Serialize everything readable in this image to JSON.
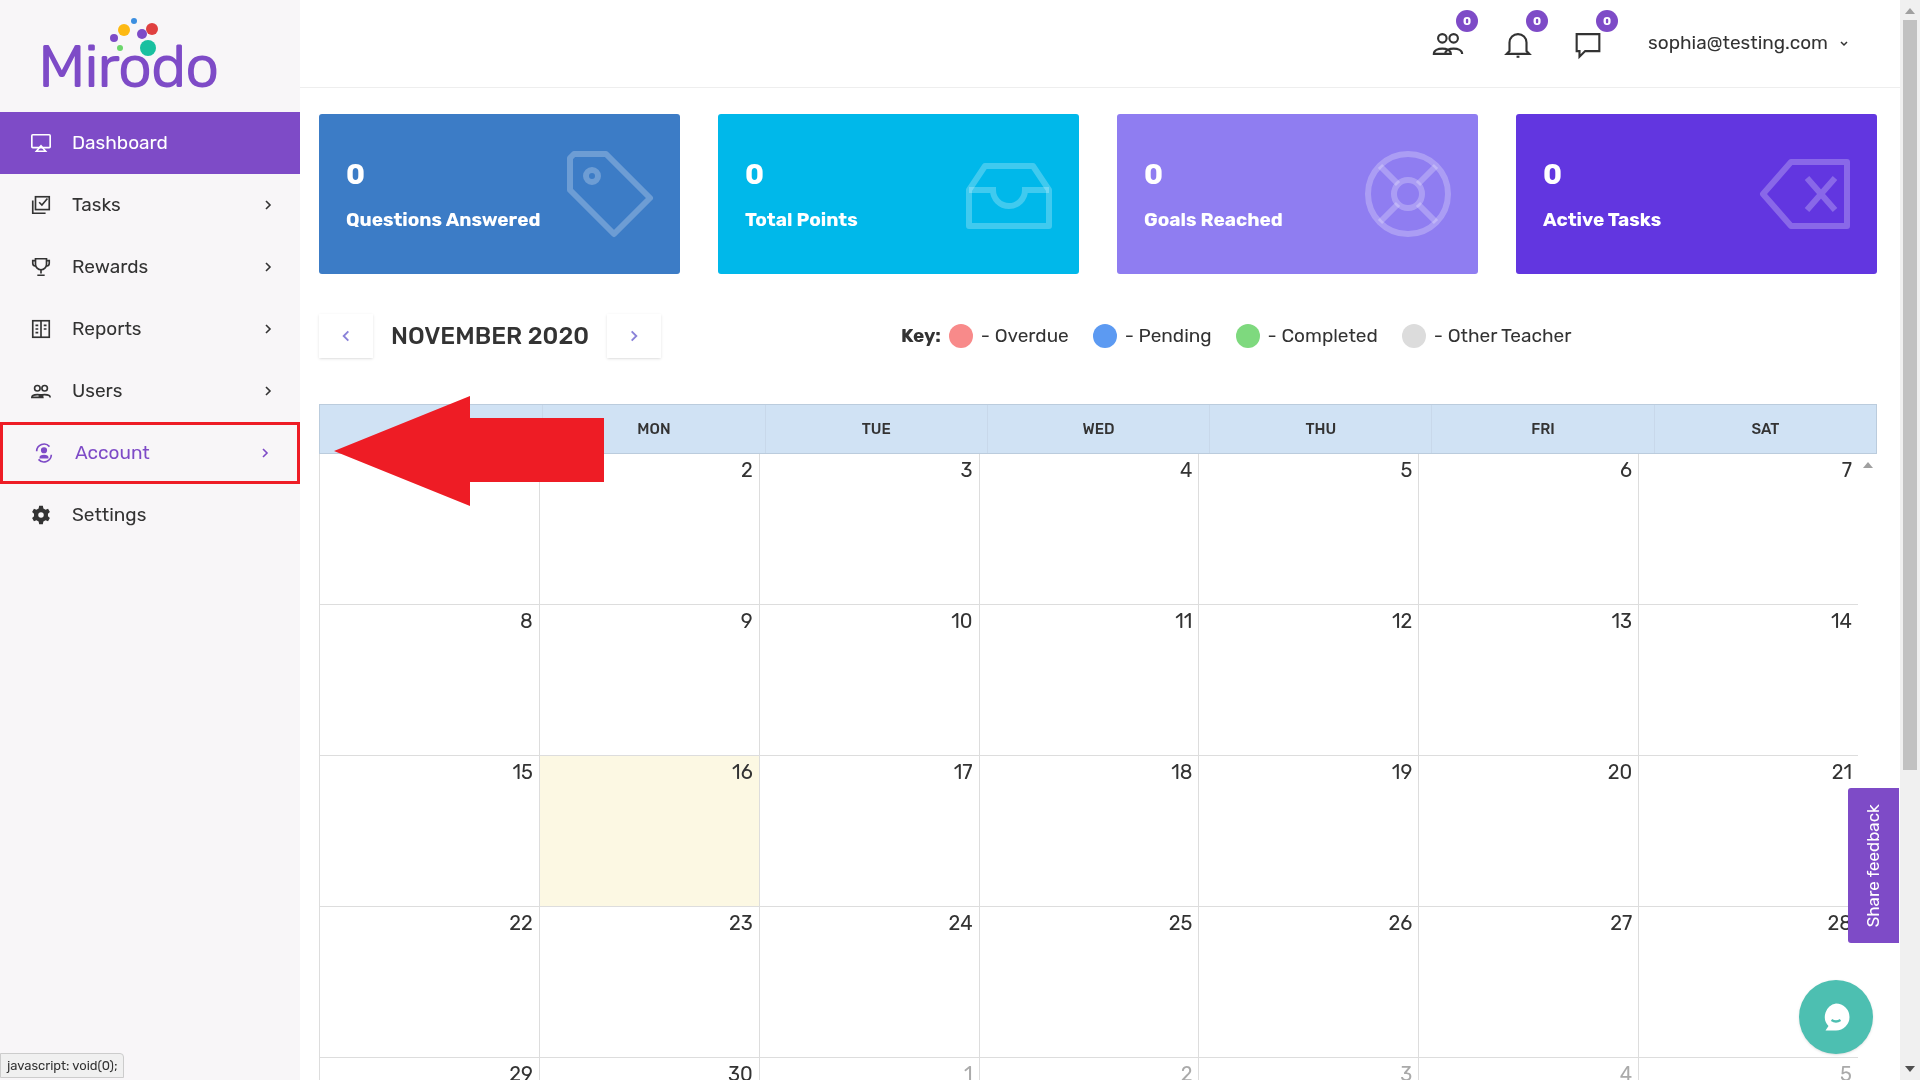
{
  "logo": {
    "text": "Mirodo"
  },
  "sidebar": {
    "items": [
      {
        "label": "Dashboard",
        "selected": true,
        "hovered": false,
        "expandable": false,
        "annotated": false
      },
      {
        "label": "Tasks",
        "selected": false,
        "hovered": false,
        "expandable": true,
        "annotated": false
      },
      {
        "label": "Rewards",
        "selected": false,
        "hovered": false,
        "expandable": true,
        "annotated": false
      },
      {
        "label": "Reports",
        "selected": false,
        "hovered": false,
        "expandable": true,
        "annotated": false
      },
      {
        "label": "Users",
        "selected": false,
        "hovered": false,
        "expandable": true,
        "annotated": false
      },
      {
        "label": "Account",
        "selected": false,
        "hovered": true,
        "expandable": true,
        "annotated": true
      },
      {
        "label": "Settings",
        "selected": false,
        "hovered": false,
        "expandable": false,
        "annotated": false
      }
    ]
  },
  "header": {
    "badges": [
      "0",
      "0",
      "0"
    ],
    "user": "sophia@testing.com"
  },
  "stats": [
    {
      "value": "0",
      "label": "Questions Answered",
      "color": "#3c7cc6"
    },
    {
      "value": "0",
      "label": "Total Points",
      "color": "#00b8ea"
    },
    {
      "value": "0",
      "label": "Goals Reached",
      "color": "#8f7df1"
    },
    {
      "value": "0",
      "label": "Active Tasks",
      "color": "#6236e0"
    }
  ],
  "calendar": {
    "month": "NOVEMBER 2020",
    "key_label": "Key:",
    "legend": [
      {
        "label": "- Overdue",
        "color": "#f88a8a"
      },
      {
        "label": "- Pending",
        "color": "#5c9af2"
      },
      {
        "label": "- Completed",
        "color": "#7ed97e"
      },
      {
        "label": "- Other Teacher",
        "color": "#dcdcdc"
      }
    ],
    "columns": [
      "MON",
      "TUE",
      "WED",
      "THU",
      "FRI",
      "SAT"
    ],
    "weeks": [
      {
        "days": [
          {
            "day": "2",
            "today": false,
            "muted": false
          },
          {
            "day": "3",
            "today": false,
            "muted": false
          },
          {
            "day": "4",
            "today": false,
            "muted": false
          },
          {
            "day": "5",
            "today": false,
            "muted": false
          },
          {
            "day": "6",
            "today": false,
            "muted": false
          },
          {
            "day": "7",
            "today": false,
            "muted": false
          }
        ]
      },
      {
        "days": [
          {
            "day": "8",
            "today": false,
            "muted": false
          },
          {
            "day": "9",
            "today": false,
            "muted": false
          },
          {
            "day": "10",
            "today": false,
            "muted": false
          },
          {
            "day": "11",
            "today": false,
            "muted": false
          },
          {
            "day": "12",
            "today": false,
            "muted": false
          },
          {
            "day": "13",
            "today": false,
            "muted": false
          },
          {
            "day": "14",
            "today": false,
            "muted": false
          }
        ]
      },
      {
        "days": [
          {
            "day": "15",
            "today": false,
            "muted": false
          },
          {
            "day": "16",
            "today": true,
            "muted": false
          },
          {
            "day": "17",
            "today": false,
            "muted": false
          },
          {
            "day": "18",
            "today": false,
            "muted": false
          },
          {
            "day": "19",
            "today": false,
            "muted": false
          },
          {
            "day": "20",
            "today": false,
            "muted": false
          },
          {
            "day": "21",
            "today": false,
            "muted": false
          }
        ]
      },
      {
        "days": [
          {
            "day": "22",
            "today": false,
            "muted": false
          },
          {
            "day": "23",
            "today": false,
            "muted": false
          },
          {
            "day": "24",
            "today": false,
            "muted": false
          },
          {
            "day": "25",
            "today": false,
            "muted": false
          },
          {
            "day": "26",
            "today": false,
            "muted": false
          },
          {
            "day": "27",
            "today": false,
            "muted": false
          },
          {
            "day": "28",
            "today": false,
            "muted": false
          }
        ]
      },
      {
        "days": [
          {
            "day": "29",
            "today": false,
            "muted": false
          },
          {
            "day": "30",
            "today": false,
            "muted": false
          },
          {
            "day": "1",
            "today": false,
            "muted": true
          },
          {
            "day": "2",
            "today": false,
            "muted": true
          },
          {
            "day": "3",
            "today": false,
            "muted": true
          },
          {
            "day": "4",
            "today": false,
            "muted": true
          },
          {
            "day": "5",
            "today": false,
            "muted": true
          }
        ]
      }
    ]
  },
  "feedback_tab": "Share feedback",
  "status_bar": "javascript: void(0);"
}
